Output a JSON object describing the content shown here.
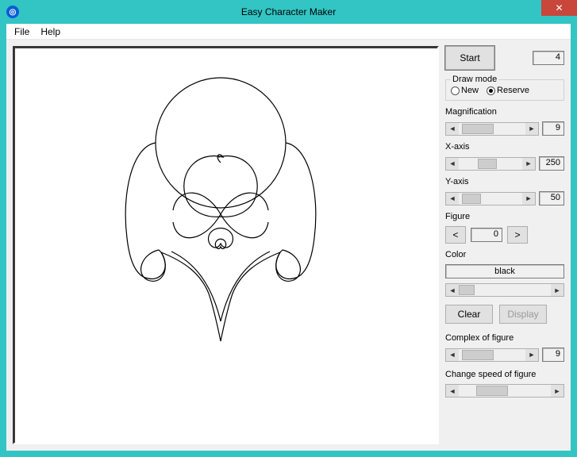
{
  "window": {
    "title": "Easy Character Maker",
    "close_glyph": "✕"
  },
  "menu": {
    "file": "File",
    "help": "Help"
  },
  "sidebar": {
    "start_label": "Start",
    "start_value": "4",
    "draw_mode": {
      "legend": "Draw mode",
      "new_label": "New",
      "reserve_label": "Reserve",
      "selected": "reserve"
    },
    "magnification": {
      "label": "Magnification",
      "value": "9",
      "thumb_pct": 10,
      "thumb_w": 40
    },
    "x_axis": {
      "label": "X-axis",
      "value": "250",
      "thumb_pct": 45,
      "thumb_w": 24
    },
    "y_axis": {
      "label": "Y-axis",
      "value": "50",
      "thumb_pct": 8,
      "thumb_w": 24
    },
    "figure": {
      "label": "Figure",
      "prev": "<",
      "next": ">",
      "value": "0"
    },
    "color": {
      "label": "Color",
      "value": "black",
      "thumb_pct": 0,
      "thumb_w": 20
    },
    "clear_label": "Clear",
    "display_label": "Display",
    "complex": {
      "label": "Complex of figure",
      "value": "9",
      "thumb_pct": 10,
      "thumb_w": 40
    },
    "speed": {
      "label": "Change speed of figure",
      "thumb_pct": 30,
      "thumb_w": 40
    }
  }
}
